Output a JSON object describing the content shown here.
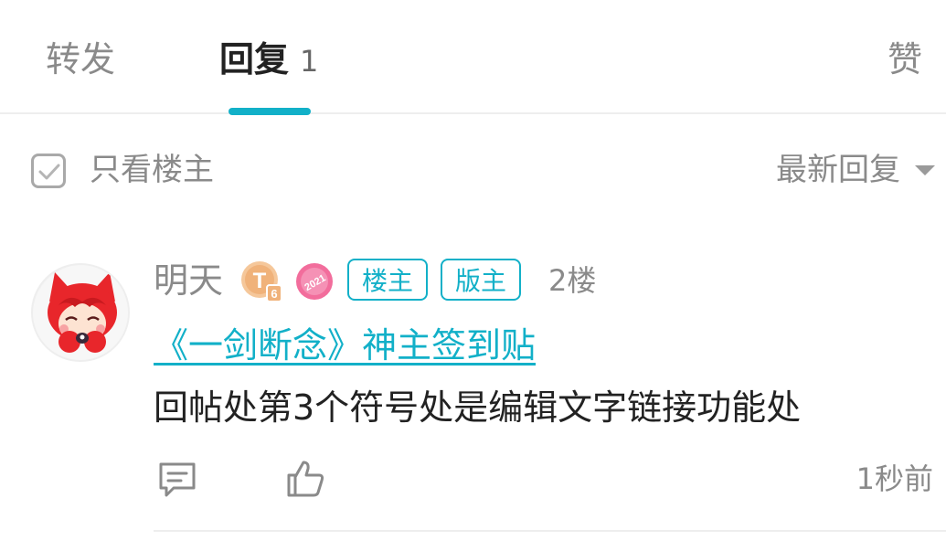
{
  "tabs": {
    "forward_label": "转发",
    "reply_label": "回复",
    "reply_count": "1",
    "like_label": "赞"
  },
  "filter": {
    "owner_only_label": "只看楼主",
    "owner_only_checked": false,
    "sort_label": "最新回复"
  },
  "post": {
    "username": "明天",
    "level_badge": "T6",
    "year_badge": "2021",
    "tags": [
      "楼主",
      "版主"
    ],
    "floor": "2楼",
    "link_text": "《一剑断念》神主签到贴",
    "body": "回帖处第3个符号处是编辑文字链接功能处",
    "time": "1秒前"
  },
  "colors": {
    "accent": "#12b0c8",
    "muted": "#8a8a8a",
    "text": "#222222"
  }
}
